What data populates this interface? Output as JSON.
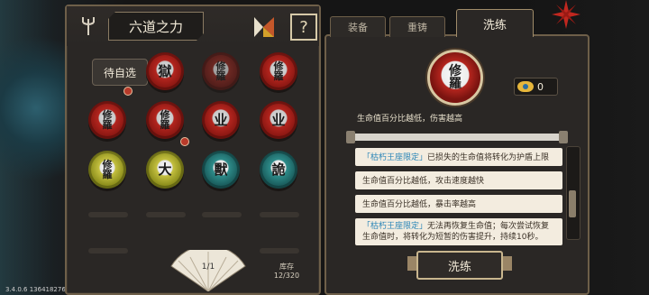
{
  "version": "3.4.0.6 136418276",
  "left_panel": {
    "title": "六道之力",
    "self_select_label": "待自选",
    "stock_label": "库存",
    "stock_count": "12/320",
    "fan_page": "1/1",
    "orbs": [
      {
        "glyph": "",
        "color": "empty"
      },
      {
        "glyph": "獄",
        "color": "red"
      },
      {
        "glyph": "修\n羅",
        "color": "red-dark"
      },
      {
        "glyph": "修\n羅",
        "color": "red"
      },
      {
        "glyph": "修\n羅",
        "color": "red"
      },
      {
        "glyph": "修\n羅",
        "color": "red"
      },
      {
        "glyph": "业",
        "color": "red"
      },
      {
        "glyph": "业",
        "color": "red"
      },
      {
        "glyph": "修\n羅",
        "color": "yellow"
      },
      {
        "glyph": "大",
        "color": "yellow"
      },
      {
        "glyph": "獸",
        "color": "teal"
      },
      {
        "glyph": "詭",
        "color": "teal"
      }
    ]
  },
  "right_panel": {
    "tabs": [
      "装备",
      "重铸",
      "洗练"
    ],
    "active_tab": "洗练",
    "big_orb_glyph": "修\n羅",
    "eye_count": "0",
    "desc_text": "生命值百分比越低，伤害越高",
    "entries": [
      {
        "prefix": "「枯朽王座限定」",
        "text": "已损失的生命值将转化为护盾上限"
      },
      {
        "prefix": "",
        "text": "生命值百分比越低，攻击速度越快"
      },
      {
        "prefix": "",
        "text": "生命值百分比越低，暴击率越高"
      },
      {
        "prefix": "「枯朽王座限定」",
        "text": "无法再恢复生命值；每次尝试恢复生命值时，将转化为短暂的伤害提升，持续10秒。"
      }
    ],
    "wash_button": "洗练"
  }
}
